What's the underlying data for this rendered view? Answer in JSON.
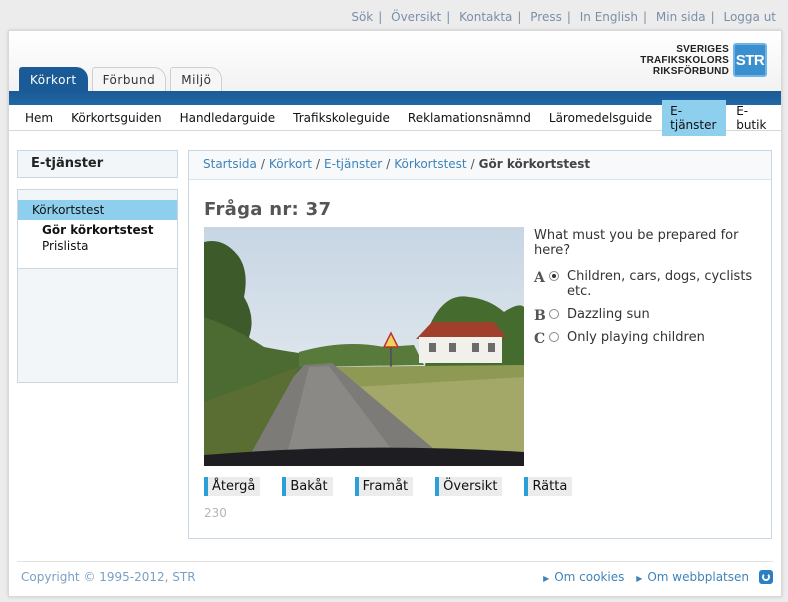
{
  "toplinks": [
    {
      "label": "Sök"
    },
    {
      "label": "Översikt"
    },
    {
      "label": "Kontakta"
    },
    {
      "label": "Press"
    },
    {
      "label": "In English"
    },
    {
      "label": "Min sida"
    },
    {
      "label": "Logga ut"
    }
  ],
  "logo": {
    "line1": "SVERIGES",
    "line2": "TRAFIKSKOLORS",
    "line3": "RIKSFÖRBUND",
    "badge": "STR"
  },
  "tabs": [
    {
      "label": "Körkort",
      "active": true
    },
    {
      "label": "Förbund",
      "active": false
    },
    {
      "label": "Miljö",
      "active": false
    }
  ],
  "nav": [
    {
      "label": "Hem"
    },
    {
      "label": "Körkortsguiden"
    },
    {
      "label": "Handledarguide"
    },
    {
      "label": "Trafikskoleguide"
    },
    {
      "label": "Reklamationsnämnd"
    },
    {
      "label": "Läromedelsguide"
    },
    {
      "label": "E-tjänster"
    },
    {
      "label": "E-butik"
    }
  ],
  "sidebar": {
    "title": "E-tjänster",
    "active": "Körkortstest",
    "sub1": "Gör körkortstest",
    "sub2": "Prislista"
  },
  "breadcrumb": {
    "items": [
      "Startsida",
      "Körkort",
      "E-tjänster",
      "Körkortstest"
    ],
    "current": "Gör körkortstest"
  },
  "question": {
    "title": "Fråga nr: 37",
    "text": "What must you be prepared for here?",
    "answers": [
      {
        "letter": "A",
        "text": "Children, cars, dogs, cyclists etc.",
        "checked": true
      },
      {
        "letter": "B",
        "text": "Dazzling sun",
        "checked": false
      },
      {
        "letter": "C",
        "text": "Only playing children",
        "checked": false
      }
    ]
  },
  "buttons": {
    "back_to": "Återgå",
    "back": "Bakåt",
    "forward": "Framåt",
    "overview": "Översikt",
    "correct": "Rätta"
  },
  "counter": "230",
  "footer": {
    "copyright": "Copyright © 1995-2012, STR",
    "cookies": "Om cookies",
    "about": "Om webbplatsen"
  },
  "colors": {
    "brand_blue": "#1a5a96",
    "active_highlight": "#8fcfee",
    "link": "#3f83b8"
  }
}
